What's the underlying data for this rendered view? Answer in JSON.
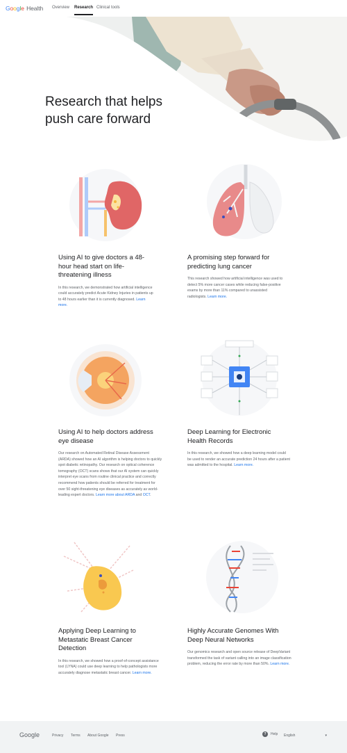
{
  "nav": {
    "logo_google": [
      "G",
      "o",
      "o",
      "g",
      "l",
      "e"
    ],
    "logo_health": "Health",
    "tabs": [
      {
        "label": "Overview",
        "active": false
      },
      {
        "label": "Research",
        "active": true
      },
      {
        "label": "Clinical tools",
        "active": false
      }
    ]
  },
  "hero": {
    "title": "Research that helps push care forward"
  },
  "cards": [
    {
      "title": "Using AI to give doctors a 48-hour head start on life-threatening illness",
      "text": "In this research, we demonstrated how artificial intelligence could accurately predict Acute Kidney Injuries in patients up to 48 hours earlier than it is currently diagnosed.",
      "links": [
        "Learn more."
      ]
    },
    {
      "title": "A promising step forward for predicting lung cancer",
      "text": "This research showed how artificial intelligence was used to detect 5% more cancer cases while reducing false-positive exams by more than 11% compared to unassisted radiologists.",
      "links": [
        "Learn more."
      ]
    },
    {
      "title": "Using AI to help doctors address eye disease",
      "text": "Our research on Automated Retinal Disease Assessment (ARDA) showed how an AI algorithm is helping doctors to quickly spot diabetic retinopathy. Our research on optical coherence tomography (OCT) scans shows that our AI system can quickly interpret eye scans from routine clinical practice and correctly recommend how patients should be referred for treatment for over 50 sight-threatening eye diseases as accurately as world-leading expert doctors.",
      "links": [
        "Learn more about ARDA",
        "and",
        "OCT",
        "."
      ]
    },
    {
      "title": "Deep Learning for Electronic Health Records",
      "text": "In this research, we showed how a deep learning model could be used to render an accurate prediction 24 hours after a patient was admitted to the hospital.",
      "links": [
        "Learn more."
      ]
    },
    {
      "title": "Applying Deep Learning to Metastatic Breast Cancer Detection",
      "text": "In this research, we showed how a proof-of-concept assistance tool (LYNA) could use deep learning to help pathologists more accurately diagnose metastatic breast cancer.",
      "links": [
        "Learn more."
      ]
    },
    {
      "title": "Highly Accurate Genomes With Deep Neural Networks",
      "text": "Our genomics research and open source release of DeepVariant transformed the task of variant calling into an image classification problem, reducing the error rate by more than 50%.",
      "links": [
        "Learn more."
      ]
    }
  ],
  "footer": {
    "logo": "Google",
    "links": [
      "Privacy",
      "Terms",
      "About Google",
      "Press"
    ],
    "help": "Help",
    "help_icon": "?",
    "language": "English",
    "dropdown_icon": "▾"
  },
  "colors": {
    "link": "#1a73e8",
    "text": "#202124",
    "muted": "#5f6368",
    "footer_bg": "#f1f3f4"
  },
  "icons": [
    "question-circle-icon",
    "chevron-down-icon"
  ]
}
